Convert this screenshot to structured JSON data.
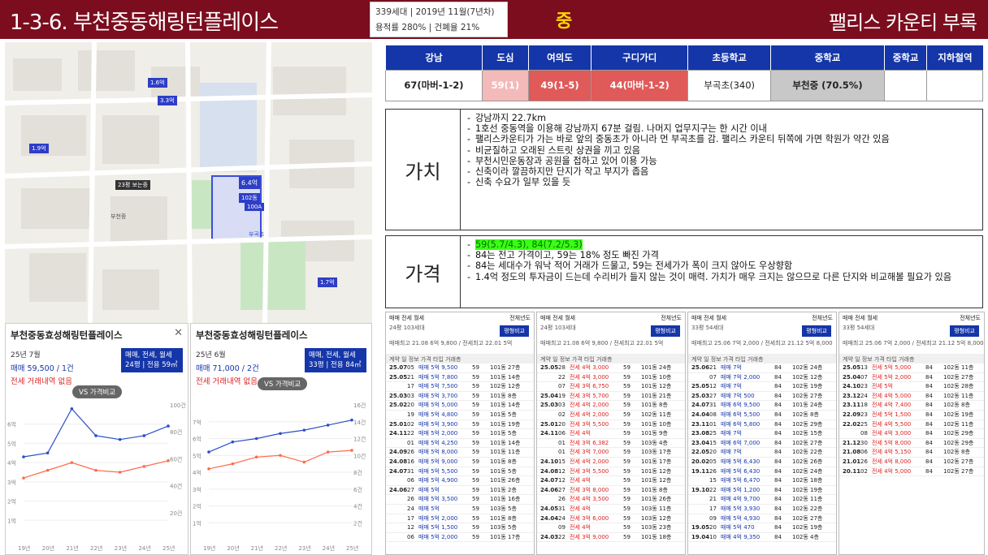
{
  "header": {
    "title": "1-3-6. 부천중동해링턴플레이스",
    "info_line1": "339세대 | 2019년 11월(7년차)",
    "info_line2": "용적률 280% | 건폐율 21%",
    "grade": "중",
    "note": "팰리스 카운티 부록"
  },
  "colors": {
    "header_bg": "#7b0d1e",
    "accent_blue": "#1536a8",
    "grade_yellow": "#ffd800"
  },
  "commute_table": {
    "headers": [
      "강남",
      "도심",
      "여의도",
      "구디가디",
      "초등학교",
      "중학교",
      "중학교",
      "지하철역"
    ],
    "values": [
      "67(마버-1-2)",
      "59(1)",
      "49(1-5)",
      "44(마버-1-2)",
      "부곡초(340)",
      "부천중 (70.5%)",
      "",
      ""
    ]
  },
  "value_section": {
    "label": "가치",
    "items": [
      "강남까지 22.7km",
      "1호선 중동역을 이용해 강남까지 67분 걸림. 나머지 업무지구는 한 시간 이내",
      "팰리스카운티가 가는 바로 앞의 중동초가 아니라 먼 부곡초를 감. 팰리스 카운티 뒤쪽에 가면 학원가 약간 있음",
      "비균질하고 오래된 스트릿 상권을 끼고 있음",
      "부천시민운동장과 공원을 접하고 있어 이용 가능",
      "신축이라 깔끔하지만 단지가 작고 부지가 좁음",
      "신축 수요가 일부 있을 듯"
    ]
  },
  "price_section": {
    "label": "가격",
    "highlight": "59(5.7/4.3), 84(7.2/5.3)",
    "items": [
      "84는 전고 가격이고, 59는 18% 정도 빠진 가격",
      "84는 세대수가 워낙 적어 거래가 드물고, 59는 전세가가 폭이 크지 않아도 우상향함",
      "1.4억 정도의 투자금이 드는데 수리비가 들지 않는 것이 매력. 가치가 매우 크지는 않으므로 다른 단지와 비교해볼 필요가 있음"
    ]
  },
  "map": {
    "labels": [
      "23평 보는중",
      "6.4억",
      "102동",
      "100A",
      "1.9억",
      "3.3억",
      "1.6억",
      "1.7억",
      "부천중",
      "부곡초"
    ]
  },
  "chart_panels": [
    {
      "title": "부천중동효성해링턴플레이스",
      "date": "25년 7월",
      "price": "매매 59,500 / 1건",
      "no_jeonse": "전세 거래내역 없음",
      "btn_line1": "매매, 전세, 월세",
      "btn_line2": "24평 | 전용 59㎡",
      "vs": "VS 가격비교"
    },
    {
      "title": "부천중동효성해링턴플레이스",
      "date": "25년 6월",
      "price": "매매 71,000 / 2건",
      "no_jeonse": "전세 거래내역 없음",
      "btn_line1": "매매, 전세, 월세",
      "btn_line2": "33평 | 전용 84㎡",
      "vs": "VS 가격비교"
    }
  ],
  "chart_data": [
    {
      "type": "line",
      "x": [
        "19년",
        "20년",
        "21년",
        "22년",
        "23년",
        "24년",
        "25년"
      ],
      "ylim": [
        0,
        7
      ],
      "ylim_right": [
        0,
        100
      ],
      "yticks_left": [
        "1억",
        "2억",
        "3억",
        "4억",
        "5억",
        "6억"
      ],
      "yticks_right": [
        "20건",
        "40건",
        "60건",
        "80건",
        "100건"
      ],
      "series": [
        {
          "color": "#2b4fc8",
          "values": [
            4.3,
            4.5,
            6.8,
            5.4,
            5.2,
            5.4,
            5.9
          ]
        },
        {
          "color": "#ff6b4a",
          "values": [
            3.2,
            3.6,
            4.0,
            3.6,
            3.5,
            3.8,
            4.1
          ]
        }
      ]
    },
    {
      "type": "line",
      "x": [
        "19년",
        "20년",
        "21년",
        "22년",
        "23년",
        "24년",
        "25년"
      ],
      "ylim": [
        0,
        8
      ],
      "ylim_right": [
        0,
        16
      ],
      "yticks_left": [
        "1억",
        "2억",
        "3억",
        "4억",
        "5억",
        "6억",
        "7억"
      ],
      "yticks_right": [
        "2건",
        "4건",
        "6건",
        "8건",
        "10건",
        "12건",
        "14건",
        "16건"
      ],
      "series": [
        {
          "color": "#2b4fc8",
          "values": [
            5.2,
            5.8,
            6.0,
            6.3,
            6.5,
            6.8,
            7.1
          ]
        },
        {
          "color": "#ff6b4a",
          "values": [
            4.2,
            4.5,
            4.9,
            5.0,
            4.6,
            5.2,
            5.3
          ]
        }
      ]
    }
  ],
  "tx_panels": [
    {
      "tabs": "매매 전세 월세",
      "rank": "전체년도",
      "area": "24평 103세대",
      "btn": "평형비교",
      "hi": "매매최고 21.08 6억 9,800 / 전세최고 22.01 5억",
      "head": "계약 일 정보 가격 타입 거래층",
      "rows": [
        [
          "25.07",
          "05",
          "매매 5억 9,500",
          "59",
          "101동 27층"
        ],
        [
          "25.05",
          "21",
          "매매 5억 7,800",
          "59",
          "101동 14층"
        ],
        [
          "",
          "17",
          "매매 5억 7,500",
          "59",
          "102동 12층"
        ],
        [
          "25.03",
          "03",
          "매매 5억 3,700",
          "59",
          "101동 8층"
        ],
        [
          "25.02",
          "20",
          "매매 5억 5,000",
          "59",
          "101동 14층"
        ],
        [
          "",
          "19",
          "매매 5억 4,800",
          "59",
          "101동 5층"
        ],
        [
          "25.01",
          "02",
          "매매 5억 3,900",
          "59",
          "101동 19층"
        ],
        [
          "24.11",
          "22",
          "매매 5억 2,000",
          "59",
          "101동 5층"
        ],
        [
          "",
          "01",
          "매매 5억 4,250",
          "59",
          "101동 14층"
        ],
        [
          "24.09",
          "26",
          "매매 5억 8,000",
          "59",
          "101동 11층"
        ],
        [
          "24.08",
          "16",
          "매매 5억 9,000",
          "59",
          "101동 8층"
        ],
        [
          "24.07",
          "31",
          "매매 5억 5,500",
          "59",
          "101동 5층"
        ],
        [
          "",
          "06",
          "매매 5억 4,900",
          "59",
          "101동 26층"
        ],
        [
          "24.06",
          "27",
          "매매 5억",
          "59",
          "101동 2층"
        ],
        [
          "",
          "26",
          "매매 5억 3,500",
          "59",
          "101동 16층"
        ],
        [
          "",
          "24",
          "매매 5억",
          "59",
          "103동 5층"
        ],
        [
          "",
          "17",
          "매매 5억 2,000",
          "59",
          "101동 8층"
        ],
        [
          "",
          "12",
          "매매 5억 1,500",
          "59",
          "103동 5층"
        ],
        [
          "",
          "06",
          "매매 5억 2,000",
          "59",
          "101동 17층"
        ]
      ]
    },
    {
      "tabs": "매매 전세 월세",
      "rank": "전체년도",
      "area": "24평 103세대",
      "btn": "평형비교",
      "hi": "매매최고 21.08 6억 9,800 / 전세최고 22.01 5억",
      "head": "계약 일 정보 가격 타입 거래층",
      "rows": [
        [
          "25.05",
          "28",
          "전세 4억 3,000",
          "59",
          "101동 24층"
        ],
        [
          "",
          "22",
          "전세 4억 3,000",
          "59",
          "101동 10층"
        ],
        [
          "",
          "07",
          "전세 3억 6,750",
          "59",
          "101동 12층"
        ],
        [
          "25.04",
          "19",
          "전세 3억 5,700",
          "59",
          "101동 21층"
        ],
        [
          "25.03",
          "03",
          "전세 4억 2,000",
          "59",
          "101동 8층"
        ],
        [
          "",
          "02",
          "전세 4억 2,000",
          "59",
          "102동 11층"
        ],
        [
          "25.01",
          "20",
          "전세 3억 5,500",
          "59",
          "101동 10층"
        ],
        [
          "24.11",
          "06",
          "전세 4억",
          "59",
          "101동 9층"
        ],
        [
          "",
          "01",
          "전세 3억 6,382",
          "59",
          "103동 4층"
        ],
        [
          "",
          "01",
          "전세 3억 7,000",
          "59",
          "103동 17층"
        ],
        [
          "24.10",
          "15",
          "전세 4억 2,000",
          "59",
          "101동 17층"
        ],
        [
          "24.08",
          "12",
          "전세 3억 5,500",
          "59",
          "101동 12층"
        ],
        [
          "24.07",
          "12",
          "전세 4억",
          "59",
          "101동 12층"
        ],
        [
          "24.06",
          "27",
          "전세 3억 8,000",
          "59",
          "101동 8층"
        ],
        [
          "",
          "26",
          "전세 4억 3,500",
          "59",
          "101동 26층"
        ],
        [
          "24.05",
          "31",
          "전세 4억",
          "59",
          "103동 11층"
        ],
        [
          "24.04",
          "24",
          "전세 3억 6,000",
          "59",
          "103동 12층"
        ],
        [
          "",
          "09",
          "전세 4억",
          "59",
          "103동 23층"
        ],
        [
          "24.03",
          "22",
          "전세 3억 9,000",
          "59",
          "101동 18층"
        ]
      ]
    },
    {
      "tabs": "매매 전세 월세",
      "rank": "전체년도",
      "area": "33평 54세대",
      "btn": "평형비교",
      "hi": "매매최고 25.06 7억 2,000 / 전세최고 21.12 5억 8,000",
      "head": "계약 일 정보 가격 타입 거래층",
      "rows": [
        [
          "25.06",
          "21",
          "매매 7억",
          "84",
          "102동 24층"
        ],
        [
          "",
          "07",
          "매매 7억 2,000",
          "84",
          "102동 12층"
        ],
        [
          "25.05",
          "12",
          "매매 7억",
          "84",
          "102동 19층"
        ],
        [
          "25.03",
          "27",
          "매매 7억 500",
          "84",
          "102동 27층"
        ],
        [
          "24.07",
          "31",
          "매매 6억 9,500",
          "84",
          "101동 24층"
        ],
        [
          "24.04",
          "08",
          "매매 6억 5,500",
          "84",
          "102동 8층"
        ],
        [
          "23.11",
          "01",
          "매매 6억 5,800",
          "84",
          "102동 29층"
        ],
        [
          "23.08",
          "25",
          "매매 7억",
          "84",
          "102동 15층"
        ],
        [
          "23.04",
          "15",
          "매매 6억 7,000",
          "84",
          "102동 27층"
        ],
        [
          "22.05",
          "20",
          "매매 7억",
          "84",
          "102동 22층"
        ],
        [
          "20.02",
          "05",
          "매매 5억 6,430",
          "84",
          "102동 26층"
        ],
        [
          "19.11",
          "26",
          "매매 5억 6,430",
          "84",
          "102동 24층"
        ],
        [
          "",
          "15",
          "매매 5억 6,470",
          "84",
          "102동 18층"
        ],
        [
          "19.10",
          "22",
          "매매 5억 1,200",
          "84",
          "102동 19층"
        ],
        [
          "",
          "21",
          "매매 4억 9,700",
          "84",
          "102동 11층"
        ],
        [
          "",
          "17",
          "매매 5억 3,930",
          "84",
          "102동 22층"
        ],
        [
          "",
          "09",
          "매매 5억 4,930",
          "84",
          "102동 27층"
        ],
        [
          "19.05",
          "20",
          "매매 5억 470",
          "84",
          "102동 19층"
        ],
        [
          "19.04",
          "10",
          "매매 4억 9,350",
          "84",
          "102동 4층"
        ]
      ]
    },
    {
      "tabs": "매매 전세 월세",
      "rank": "전체년도",
      "area": "33평 54세대",
      "btn": "평형비교",
      "hi": "매매최고 25.06 7억 2,000 / 전세최고 21.12 5억 8,000",
      "head": "계약 일 정보 가격 타입 거래층",
      "rows": [
        [
          "25.05",
          "13",
          "전세 5억 5,000",
          "84",
          "102동 11층"
        ],
        [
          "25.04",
          "07",
          "전세 5억 2,000",
          "84",
          "102동 27층"
        ],
        [
          "24.10",
          "23",
          "전세 5억",
          "84",
          "102동 28층"
        ],
        [
          "23.12",
          "24",
          "전세 4억 5,000",
          "84",
          "102동 11층"
        ],
        [
          "23.11",
          "18",
          "전세 4억 7,400",
          "84",
          "102동 8층"
        ],
        [
          "22.09",
          "23",
          "전세 5억 1,500",
          "84",
          "102동 19층"
        ],
        [
          "22.02",
          "25",
          "전세 4억 5,500",
          "84",
          "102동 11층"
        ],
        [
          "",
          "08",
          "전세 4억 3,000",
          "84",
          "102동 29층"
        ],
        [
          "21.12",
          "30",
          "전세 5억 8,000",
          "84",
          "102동 29층"
        ],
        [
          "21.08",
          "06",
          "전세 4억 5,150",
          "84",
          "102동 8층"
        ],
        [
          "21.01",
          "26",
          "전세 4억 8,000",
          "84",
          "102동 27층"
        ],
        [
          "20.11",
          "02",
          "전세 4억 5,000",
          "84",
          "102동 27층"
        ]
      ]
    }
  ]
}
